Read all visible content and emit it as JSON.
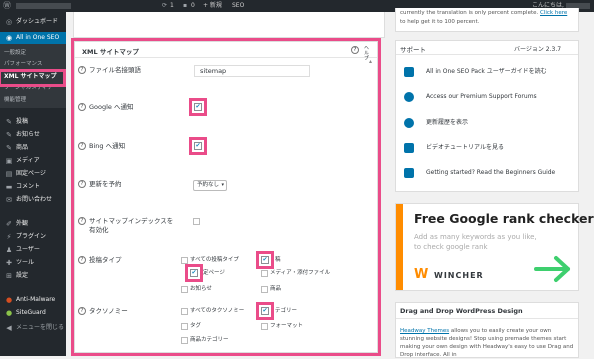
{
  "adminbar": {
    "comment_count": "0",
    "new_label": "+ 新規",
    "seo_label": "SEO",
    "greeting": "こんにちは,",
    "update_count": "1"
  },
  "sidebar": {
    "items": [
      {
        "label": "ダッシュボード",
        "icon": "dashboard-icon"
      },
      {
        "label": "All in One SEO",
        "icon": "aioseo-icon"
      },
      {
        "label": "投稿",
        "icon": "pin-icon"
      },
      {
        "label": "お知らせ",
        "icon": "pin-icon"
      },
      {
        "label": "商品",
        "icon": "pin-icon"
      },
      {
        "label": "メディア",
        "icon": "media-icon"
      },
      {
        "label": "固定ページ",
        "icon": "page-icon"
      },
      {
        "label": "コメント",
        "icon": "comment-icon"
      },
      {
        "label": "お問い合わせ",
        "icon": "mail-icon"
      },
      {
        "label": "外観",
        "icon": "brush-icon"
      },
      {
        "label": "プラグイン",
        "icon": "plugin-icon"
      },
      {
        "label": "ユーザー",
        "icon": "user-icon"
      },
      {
        "label": "ツール",
        "icon": "wrench-icon"
      },
      {
        "label": "設定",
        "icon": "settings-icon"
      },
      {
        "label": "Anti-Malware",
        "icon": "shield-icon"
      },
      {
        "label": "SiteGuard",
        "icon": "guard-icon"
      },
      {
        "label": "メニューを閉じる",
        "icon": "collapse-icon"
      }
    ],
    "submenu": [
      "一般設定",
      "パフォーマンス",
      "XML サイトマップ",
      "ソーシャルメディア",
      "機能管理"
    ]
  },
  "notice": {
    "line1": "currently the translation is only percent complete.",
    "link1": "Click here",
    "line2": "to help get it to 100 percent."
  },
  "sitemap": {
    "title": "XML サイトマップ",
    "help_label": "ヘルプ",
    "filename_label": "ファイル名接頭語",
    "filename_value": "sitemap",
    "google_label": "Google へ通知",
    "bing_label": "Bing へ通知",
    "schedule_label": "更新を予約",
    "schedule_value": "予約なし",
    "index_label": "サイトマップインデックスを有効化",
    "post_types_label": "投稿タイプ",
    "post_types": [
      {
        "label": "すべての投稿タイプ",
        "checked": false
      },
      {
        "label": "稿",
        "checked": true
      },
      {
        "label": "定ページ",
        "checked": true
      },
      {
        "label": "メディア・添付ファイル",
        "checked": false
      },
      {
        "label": "お知らせ",
        "checked": false
      },
      {
        "label": "商品",
        "checked": false
      }
    ],
    "taxonomy_label": "タクソノミー",
    "taxonomies": [
      {
        "label": "すべてのタクソノミー",
        "checked": false
      },
      {
        "label": "テゴリー",
        "checked": true
      },
      {
        "label": "タグ",
        "checked": false
      },
      {
        "label": "フォーマット",
        "checked": false
      },
      {
        "label": "商品カテゴリー",
        "checked": false
      }
    ]
  },
  "support": {
    "title": "サポート",
    "version": "バージョン 2.3.7",
    "items": [
      "All in One SEO Pack ユーザーガイドを読む",
      "Access our Premium Support Forums",
      "更新履歴を表示",
      "ビデオチュートリアルを見る",
      "Getting started? Read the Beginners Guide"
    ]
  },
  "ad": {
    "headline": "Free Google rank checker",
    "subtext": "Add as many keywords as you like, to check google rank",
    "brand": "WINCHER"
  },
  "dnd": {
    "title": "Drag and Drop WordPress Design",
    "link": "Headway Themes",
    "text": "allows you to easily create your own stunning website designs! Stop using premade themes start making your own design with Headway's easy to use Drag and Drop interface. All in"
  },
  "colors": {
    "highlight": "#ea4c89",
    "admin_dark": "#23282d",
    "accent_blue": "#0073aa",
    "green_arrow": "#3ecf6e"
  }
}
